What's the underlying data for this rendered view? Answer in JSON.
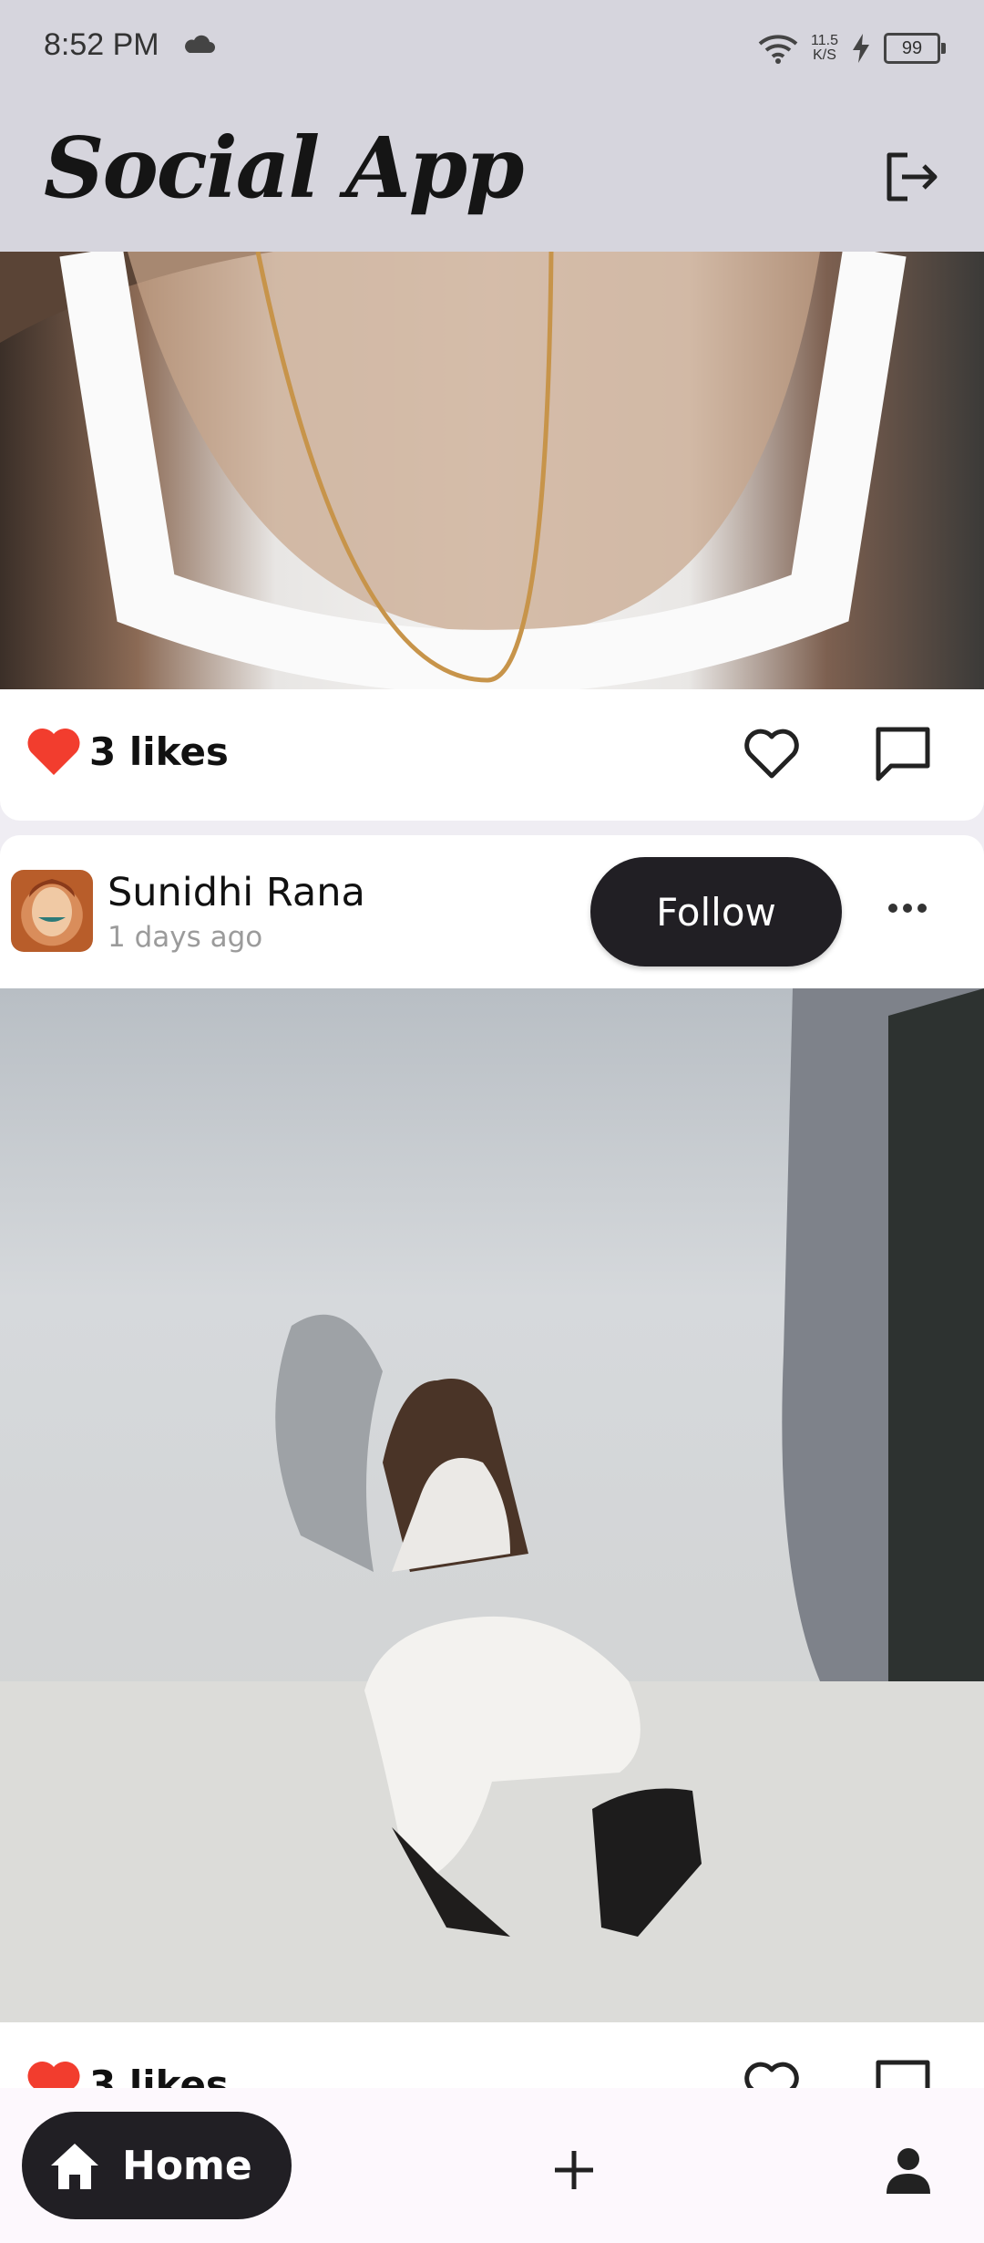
{
  "status_bar": {
    "time": "8:52 PM",
    "net_speed_value": "11.5",
    "net_speed_unit": "K/S",
    "battery": "99"
  },
  "app_bar": {
    "logo": "Social App",
    "logout_icon": "logout-icon"
  },
  "feed": {
    "posts": [
      {
        "likes_label": "3 likes",
        "image_desc_icon": "photo"
      },
      {
        "author": "Sunidhi Rana",
        "time_ago": "1 days ago",
        "follow_label": "Follow",
        "likes_label": "3 likes"
      }
    ]
  },
  "bottom_nav": {
    "home_label": "Home",
    "items": [
      "home-icon",
      "add-icon",
      "person-icon"
    ]
  },
  "colors": {
    "accent_dark": "#211f24",
    "heart_red": "#f23d2e",
    "bar_bg": "#d6d5dd"
  }
}
